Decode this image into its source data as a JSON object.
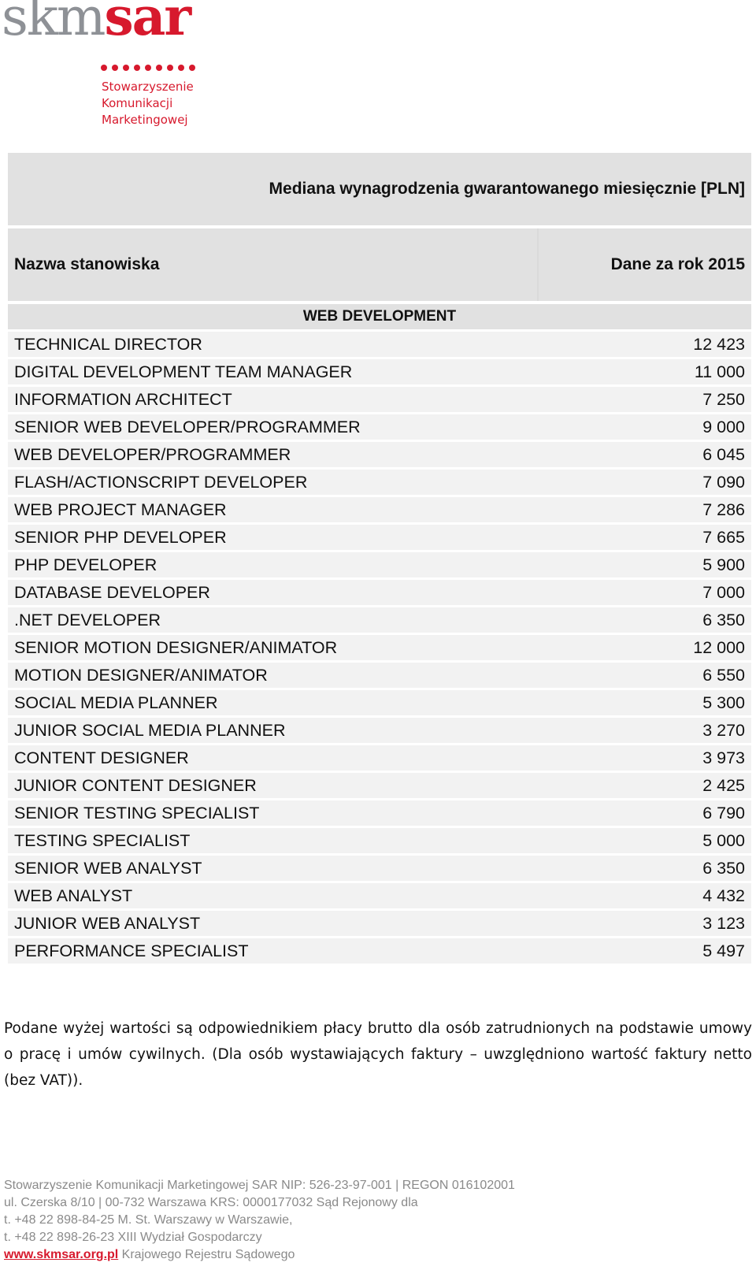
{
  "logo": {
    "word_gray": "skm",
    "word_red": "sar",
    "subtitle_lines": [
      "Stowarzyszenie",
      "Komunikacji",
      "Marketingowej"
    ],
    "brand_red": "#d7192d",
    "brand_gray": "#8e9196"
  },
  "table": {
    "title": "Mediana wynagrodzenia gwarantowanego miesięcznie [PLN]",
    "col_name": "Nazwa stanowiska",
    "col_year": "Dane za rok 2015",
    "section": "WEB DEVELOPMENT",
    "rows": [
      {
        "name": "TECHNICAL DIRECTOR",
        "value": "12 423"
      },
      {
        "name": "DIGITAL DEVELOPMENT TEAM MANAGER",
        "value": "11 000"
      },
      {
        "name": "INFORMATION ARCHITECT",
        "value": "7 250"
      },
      {
        "name": "SENIOR WEB DEVELOPER/PROGRAMMER",
        "value": "9 000"
      },
      {
        "name": "WEB DEVELOPER/PROGRAMMER",
        "value": "6 045"
      },
      {
        "name": "FLASH/ACTIONSCRIPT DEVELOPER",
        "value": "7 090"
      },
      {
        "name": "WEB PROJECT MANAGER",
        "value": "7 286"
      },
      {
        "name": "SENIOR PHP DEVELOPER",
        "value": "7 665"
      },
      {
        "name": "PHP DEVELOPER",
        "value": "5 900"
      },
      {
        "name": "DATABASE DEVELOPER",
        "value": "7 000"
      },
      {
        "name": ".NET DEVELOPER",
        "value": "6 350"
      },
      {
        "name": "SENIOR MOTION DESIGNER/ANIMATOR",
        "value": "12 000"
      },
      {
        "name": "MOTION DESIGNER/ANIMATOR",
        "value": "6 550"
      },
      {
        "name": "SOCIAL MEDIA PLANNER",
        "value": "5 300"
      },
      {
        "name": "JUNIOR SOCIAL MEDIA PLANNER",
        "value": "3 270"
      },
      {
        "name": "CONTENT DESIGNER",
        "value": "3 973"
      },
      {
        "name": "JUNIOR CONTENT DESIGNER",
        "value": "2 425"
      },
      {
        "name": "SENIOR TESTING SPECIALIST",
        "value": "6 790"
      },
      {
        "name": "TESTING SPECIALIST",
        "value": "5 000"
      },
      {
        "name": "SENIOR WEB ANALYST",
        "value": "6 350"
      },
      {
        "name": "WEB ANALYST",
        "value": "4 432"
      },
      {
        "name": "JUNIOR WEB ANALYST",
        "value": "3 123"
      },
      {
        "name": "PERFORMANCE SPECIALIST",
        "value": "5 497"
      }
    ]
  },
  "note": "Podane wyżej wartości są odpowiednikiem płacy brutto dla osób zatrudnionych na podstawie umowy o pracę i umów cywilnych. (Dla osób wystawiających faktury – uwzględniono wartość faktury netto (bez VAT)).",
  "footer": {
    "lines": [
      "Stowarzyszenie Komunikacji Marketingowej SAR NIP: 526-23-97-001 | REGON 016102001",
      "ul. Czerska 8/10 | 00-732 Warszawa KRS: 0000177032 Sąd Rejonowy dla",
      "t. +48 22 898-84-25 M. St. Warszawy w Warszawie,",
      "t. +48 22 898-26-23 XIII Wydział Gospodarczy"
    ],
    "link": "www.skmsar.org.pl",
    "last_line_rest": " Krajowego Rejestru Sądowego"
  }
}
